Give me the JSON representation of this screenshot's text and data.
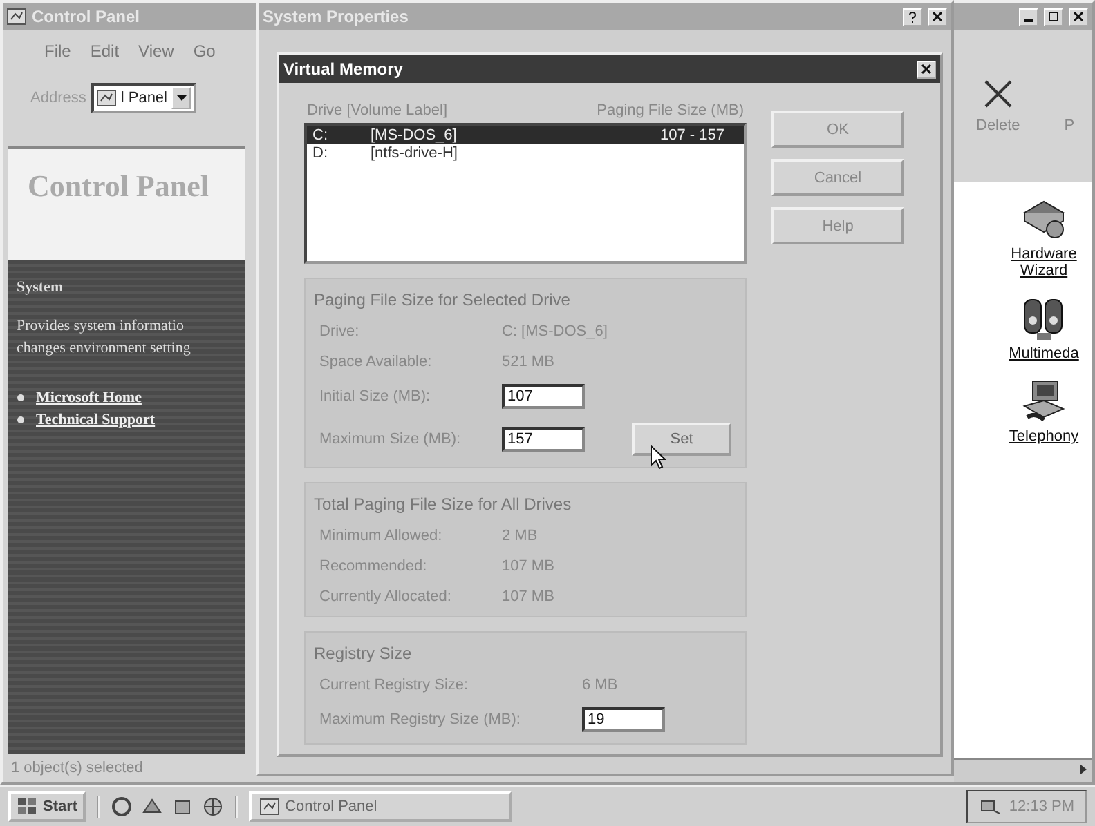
{
  "control_panel": {
    "title": "Control Panel",
    "menu": [
      "File",
      "Edit",
      "View",
      "Go"
    ],
    "address_label": "Address",
    "address_value": "l Panel",
    "heading": "Control Panel",
    "info_title": "System",
    "info_lines": [
      "Provides system informatio",
      "changes environment setting"
    ],
    "links": [
      "Microsoft Home",
      "Technical Support"
    ],
    "status": "1 object(s) selected",
    "toolbar": [
      "Delete",
      "P"
    ],
    "icons": [
      {
        "label": "Hardware Wizard",
        "kind": "hardware"
      },
      {
        "label": "Multimeda",
        "kind": "multimedia"
      },
      {
        "label": "Telephony",
        "kind": "telephony"
      }
    ]
  },
  "system_properties": {
    "title": "System Properties"
  },
  "virtual_memory": {
    "title": "Virtual Memory",
    "list_header": [
      "Drive [Volume Label]",
      "Paging File Size (MB)"
    ],
    "drives": [
      {
        "drive": "C:",
        "label": "[MS-DOS_6]",
        "size": "107 - 157",
        "selected": true
      },
      {
        "drive": "D:",
        "label": "[ntfs-drive-H]",
        "selected": false
      }
    ],
    "buttons": [
      "OK",
      "Cancel",
      "Help"
    ],
    "selected_drive": {
      "title": "Paging File Size for Selected Drive",
      "drive_label": "Drive:",
      "drive_value": "C: [MS-DOS_6]",
      "space_label": "Space Available:",
      "space_value": "521 MB",
      "initial_label": "Initial Size (MB):",
      "initial_value": "107",
      "maximum_label": "Maximum Size (MB):",
      "maximum_value": "157",
      "set_button": "Set"
    },
    "totals": {
      "title": "Total Paging File Size for All Drives",
      "rows": [
        {
          "label": "Minimum Allowed:",
          "value": "2 MB"
        },
        {
          "label": "Recommended:",
          "value": "107 MB"
        },
        {
          "label": "Currently Allocated:",
          "value": "107 MB"
        }
      ]
    },
    "registry": {
      "title": "Registry Size",
      "current_label": "Current Registry Size:",
      "current_value": "6 MB",
      "maximum_label": "Maximum Registry Size (MB):",
      "maximum_value": "19"
    }
  },
  "taskbar": {
    "start": "Start",
    "tasks": [
      {
        "label": "Control Panel",
        "selected": false
      }
    ],
    "clock": "12:13 PM"
  }
}
